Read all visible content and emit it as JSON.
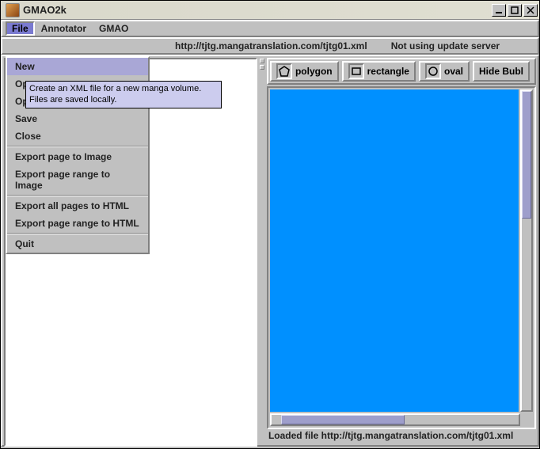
{
  "window": {
    "title": "GMAO2k"
  },
  "menubar": {
    "items": [
      "File",
      "Annotator",
      "GMAO"
    ],
    "active_index": 0
  },
  "urlbar": {
    "url": "http://tjtg.mangatranslation.com/tjtg01.xml",
    "server_status": "Not using update server"
  },
  "file_menu": {
    "items": [
      {
        "label": "New",
        "highlight": true
      },
      {
        "label": "Open"
      },
      {
        "label": "Open..."
      },
      {
        "label": "Save"
      },
      {
        "label": "Close"
      },
      {
        "sep": true
      },
      {
        "label": "Export page to Image"
      },
      {
        "label": "Export page range to Image"
      },
      {
        "sep": true
      },
      {
        "label": "Export all pages to HTML"
      },
      {
        "label": "Export page range to HTML"
      },
      {
        "sep": true
      },
      {
        "label": "Quit"
      }
    ]
  },
  "tooltip": {
    "line1": "Create an XML file for a new manga volume.",
    "line2": "Files are saved locally."
  },
  "tools": {
    "polygon": "polygon",
    "rectangle": "rectangle",
    "oval": "oval",
    "hide_bubbles": "Hide Bubl"
  },
  "status": {
    "text": "Loaded file http://tjtg.mangatranslation.com/tjtg01.xml"
  },
  "colors": {
    "canvas": "#0090ff"
  }
}
